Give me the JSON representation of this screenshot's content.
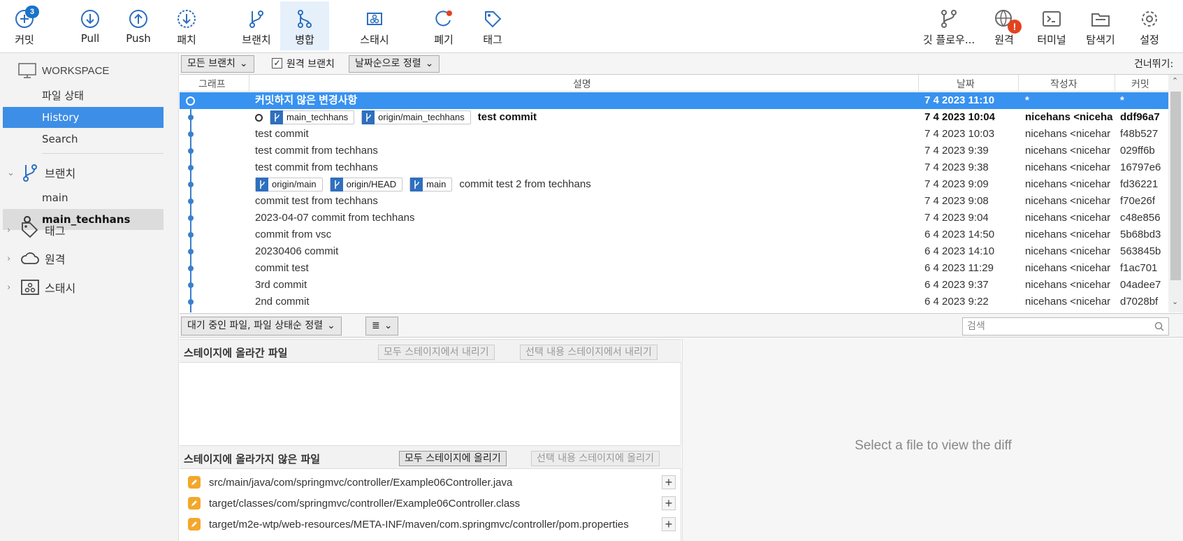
{
  "toolbar": {
    "commit": {
      "label": "커밋",
      "badge": "3"
    },
    "pull": "Pull",
    "push": "Push",
    "patch": "패치",
    "branch": "브랜치",
    "merge": "병합",
    "stash": "스태시",
    "discard": "폐기",
    "tag": "태그",
    "gitflow": "깃 플로우...",
    "remote": "원격",
    "terminal": "터미널",
    "explorer": "탐색기",
    "settings": "설정"
  },
  "sidebar": {
    "workspace": "WORKSPACE",
    "workspace_items": [
      "파일 상태",
      "History",
      "Search"
    ],
    "branches_label": "브랜치",
    "branches": [
      "main",
      "main_techhans"
    ],
    "tags_label": "태그",
    "remotes_label": "원격",
    "stashes_label": "스태시"
  },
  "filterbar": {
    "branch_filter": "모든 브랜치",
    "remote_branch_check": "원격 브랜치",
    "sort": "날짜순으로 정렬",
    "skip": "건너뛰기:"
  },
  "table": {
    "headers": [
      "그래프",
      "설명",
      "날짜",
      "작성자",
      "커밋"
    ],
    "rows": [
      {
        "desc": "커밋하지 않은 변경사항",
        "date": "7 4 2023 11:10",
        "author": "*",
        "hash": "*"
      },
      {
        "tags": [
          "main_techhans",
          "origin/main_techhans"
        ],
        "desc": "test commit",
        "date": "7 4 2023 10:04",
        "author": "nicehans <niceha",
        "hash": "ddf96a7"
      },
      {
        "desc": "test commit",
        "date": "7 4 2023 10:03",
        "author": "nicehans <nicehar",
        "hash": "f48b527"
      },
      {
        "desc": "test commit from techhans",
        "date": "7 4 2023 9:39",
        "author": "nicehans <nicehar",
        "hash": "029ff6b"
      },
      {
        "desc": "test commit from techhans",
        "date": "7 4 2023 9:38",
        "author": "nicehans <nicehar",
        "hash": "16797e6"
      },
      {
        "tags": [
          "origin/main",
          "origin/HEAD",
          "main"
        ],
        "desc": "commit test 2 from techhans",
        "date": "7 4 2023 9:09",
        "author": "nicehans <nicehar",
        "hash": "fd36221"
      },
      {
        "desc": "commit test from techhans",
        "date": "7 4 2023 9:08",
        "author": "nicehans <nicehar",
        "hash": "f70e26f"
      },
      {
        "desc": "2023-04-07 commit from techhans",
        "date": "7 4 2023 9:04",
        "author": "nicehans <nicehar",
        "hash": "c48e856"
      },
      {
        "desc": "commit from vsc",
        "date": "6 4 2023 14:50",
        "author": "nicehans <nicehar",
        "hash": "5b68bd3"
      },
      {
        "desc": "20230406 commit",
        "date": "6 4 2023 14:10",
        "author": "nicehans <nicehar",
        "hash": "563845b"
      },
      {
        "desc": "commit test",
        "date": "6 4 2023 11:29",
        "author": "nicehans <nicehar",
        "hash": "f1ac701"
      },
      {
        "desc": "3rd commit",
        "date": "6 4 2023 9:37",
        "author": "nicehans <nicehar",
        "hash": "04adee7"
      },
      {
        "desc": "2nd commit",
        "date": "6 4 2023 9:22",
        "author": "nicehans <nicehar",
        "hash": "d7028bf"
      }
    ]
  },
  "statusbar": {
    "file_sort": "대기 중인 파일, 파일 상태순 정렬",
    "view_mode": "≣",
    "search_placeholder": "검색"
  },
  "staged": {
    "title": "스테이지에 올라간 파일",
    "unstage_all": "모두 스테이지에서 내리기",
    "unstage_selected": "선택 내용 스테이지에서 내리기"
  },
  "unstaged": {
    "title": "스테이지에 올라가지 않은 파일",
    "stage_all": "모두 스테이지에 올리기",
    "stage_selected": "선택 내용 스테이지에 올리기",
    "files": [
      "src/main/java/com/springmvc/controller/Example06Controller.java",
      "target/classes/com/springmvc/controller/Example06Controller.class",
      "target/m2e-wtp/web-resources/META-INF/maven/com.springmvc/controller/pom.properties"
    ]
  },
  "diff": {
    "empty_message": "Select a file to view the diff"
  },
  "colors": {
    "accent": "#3892f0",
    "sidebar_selected": "#3d8ee6",
    "graph": "#3a7fcc",
    "modified": "#f4a72a"
  }
}
